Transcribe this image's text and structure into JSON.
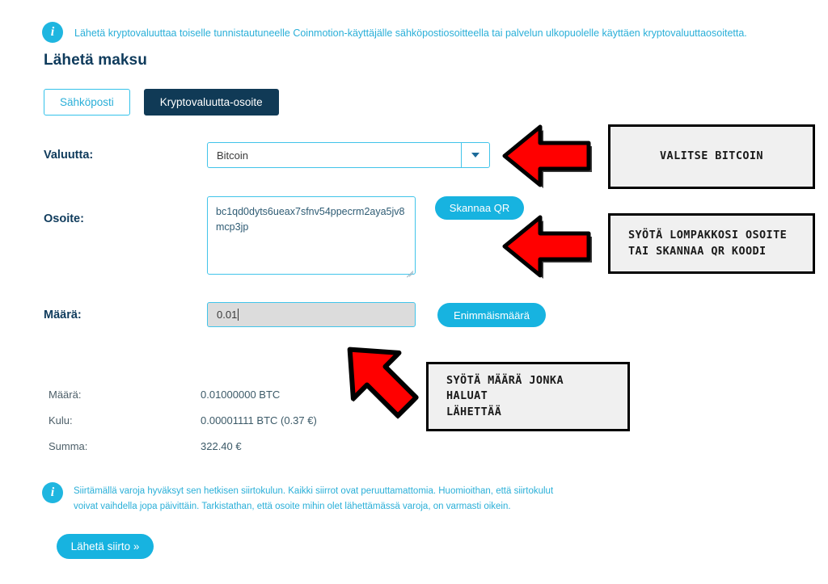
{
  "top_info": {
    "icon": "info-icon",
    "text": "Lähetä kryptovaluuttaa toiselle tunnistautuneelle Coinmotion-käyttäjälle sähköpostiosoitteella tai palvelun ulkopuolelle käyttäen kryptovaluuttaosoitetta."
  },
  "page_title": "Lähetä maksu",
  "tabs": [
    {
      "label": "Sähköposti",
      "active": false
    },
    {
      "label": "Kryptovaluutta-osoite",
      "active": true
    }
  ],
  "form": {
    "currency": {
      "label": "Valuutta:",
      "value": "Bitcoin",
      "options": [
        "Bitcoin"
      ],
      "caret_icon": "chevron-down-icon"
    },
    "address": {
      "label": "Osoite:",
      "value": "bc1qd0dyts6ueax7sfnv54ppecrm2aya5jv8mcp3jp",
      "scan_button": "Skannaa QR"
    },
    "amount": {
      "label": "Määrä:",
      "value": "0.01",
      "max_button": "Enimmäismäärä"
    }
  },
  "summary": {
    "rows": [
      {
        "key": "Määrä:",
        "value": "0.01000000 BTC"
      },
      {
        "key": "Kulu:",
        "value": "0.00001111 BTC (0.37 €)"
      },
      {
        "key": "Summa:",
        "value": "322.40 €"
      }
    ]
  },
  "bottom_info": {
    "icon": "info-icon",
    "text": "Siirtämällä varoja hyväksyt sen hetkisen siirtokulun. Kaikki siirrot ovat peruuttamattomia. Huomioithan, että siirtokulut voivat vaihdella jopa päivittäin. Tarkistathan, että osoite mihin olet lähettämässä varoja, on varmasti oikein."
  },
  "submit_button": "Lähetä siirto »",
  "annotations": [
    {
      "text": "VALITSE BITCOIN",
      "arrow": "left"
    },
    {
      "text": "SYÖTÄ LOMPAKKOSI OSOITE\nTAI SKANNAA QR KOODI",
      "arrow": "left"
    },
    {
      "text": "SYÖTÄ MÄÄRÄ JONKA HALUAT\nLÄHETTÄÄ",
      "arrow": "up-left"
    }
  ],
  "colors": {
    "accent_cyan": "#17b3e0",
    "dark_navy": "#103a56",
    "border_cyan": "#41c4ea",
    "annotation_red": "#ff0000",
    "annotation_box_bg": "#f0f0f0"
  }
}
